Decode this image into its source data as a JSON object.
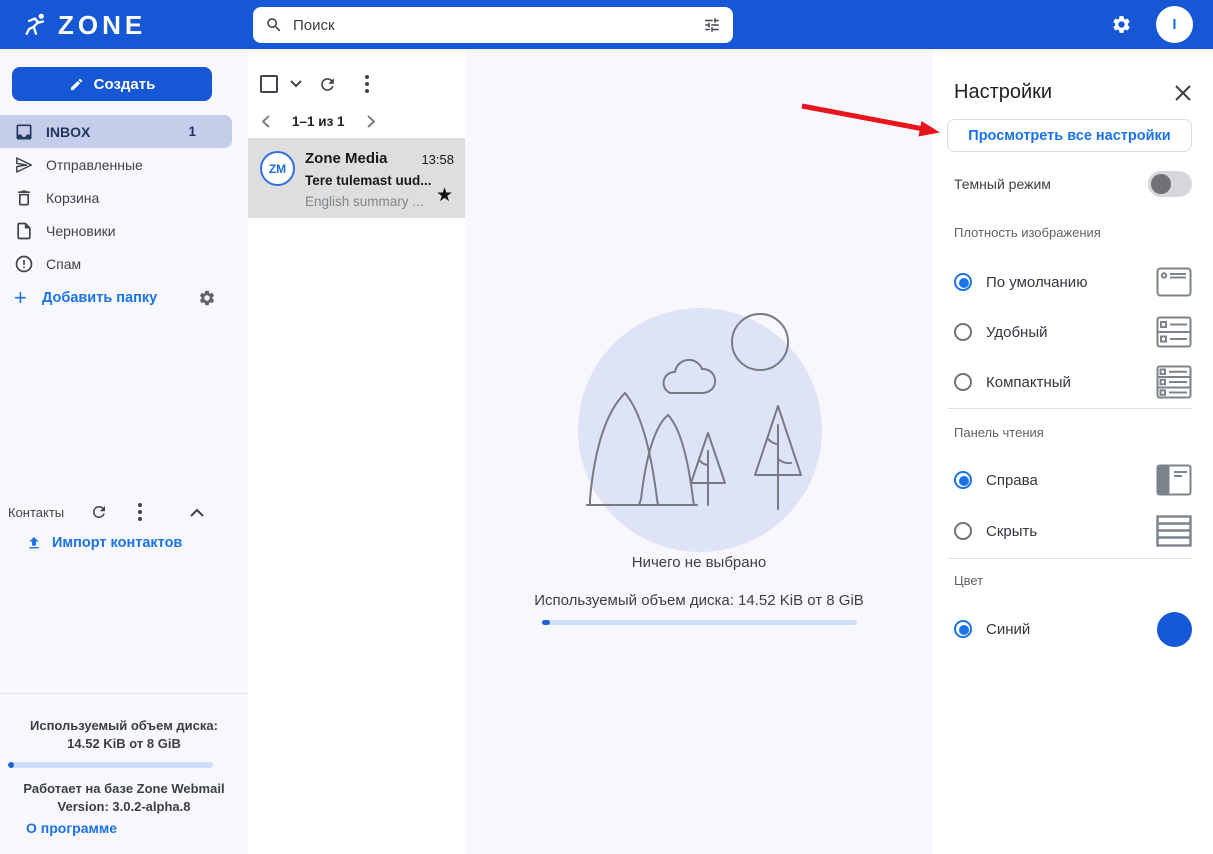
{
  "topbar": {
    "logo_text": "ZONE",
    "search_placeholder": "Поиск",
    "avatar_letter": "I"
  },
  "sidebar": {
    "compose_label": "Создать",
    "folders": [
      {
        "label": "INBOX",
        "count": "1",
        "selected": true
      },
      {
        "label": "Отправленные"
      },
      {
        "label": "Корзина"
      },
      {
        "label": "Черновики"
      },
      {
        "label": "Спам"
      }
    ],
    "add_folder_label": "Добавить папку",
    "contacts_title": "Контакты",
    "import_label": "Импорт контактов",
    "disk_usage_line1": "Используемый объем диска:",
    "disk_usage_line2": "14.52 KiB от 8 GiB",
    "powered_line1": "Работает на базе Zone Webmail",
    "powered_line2": "Version: 3.0.2-alpha.8",
    "about_label": "О программе"
  },
  "maillist": {
    "pagination": "1–1 из 1",
    "email": {
      "avatar_initials": "ZM",
      "sender": "Zone Media",
      "time": "13:58",
      "subject": "Tere tulemast uud...",
      "preview": "English summary ..."
    }
  },
  "main": {
    "empty_text": "Ничего не выбрано",
    "disk_usage": "Используемый объем диска: 14.52 KiB от 8 GiB"
  },
  "settings": {
    "title": "Настройки",
    "view_all_label": "Просмотреть все настройки",
    "dark_mode_label": "Темный режим",
    "dark_mode_on": false,
    "density_title": "Плотность изображения",
    "density_options": [
      "По умолчанию",
      "Удобный",
      "Компактный"
    ],
    "density_selected": "По умолчанию",
    "reading_title": "Панель чтения",
    "reading_options": [
      "Справа",
      "Скрыть"
    ],
    "reading_selected": "Справа",
    "color_title": "Цвет",
    "color_options": [
      "Синий"
    ],
    "color_selected": "Синий"
  },
  "icons": {
    "star": "★",
    "plus": "+"
  },
  "colors": {
    "primary_blue": "#1657d5",
    "link_blue": "#1a73e8",
    "selected_folder_bg": "#c4cde9",
    "selected_email_bg": "#dedede",
    "illustration_circle": "#dfe3f8",
    "arrow_red": "#e8141e"
  }
}
